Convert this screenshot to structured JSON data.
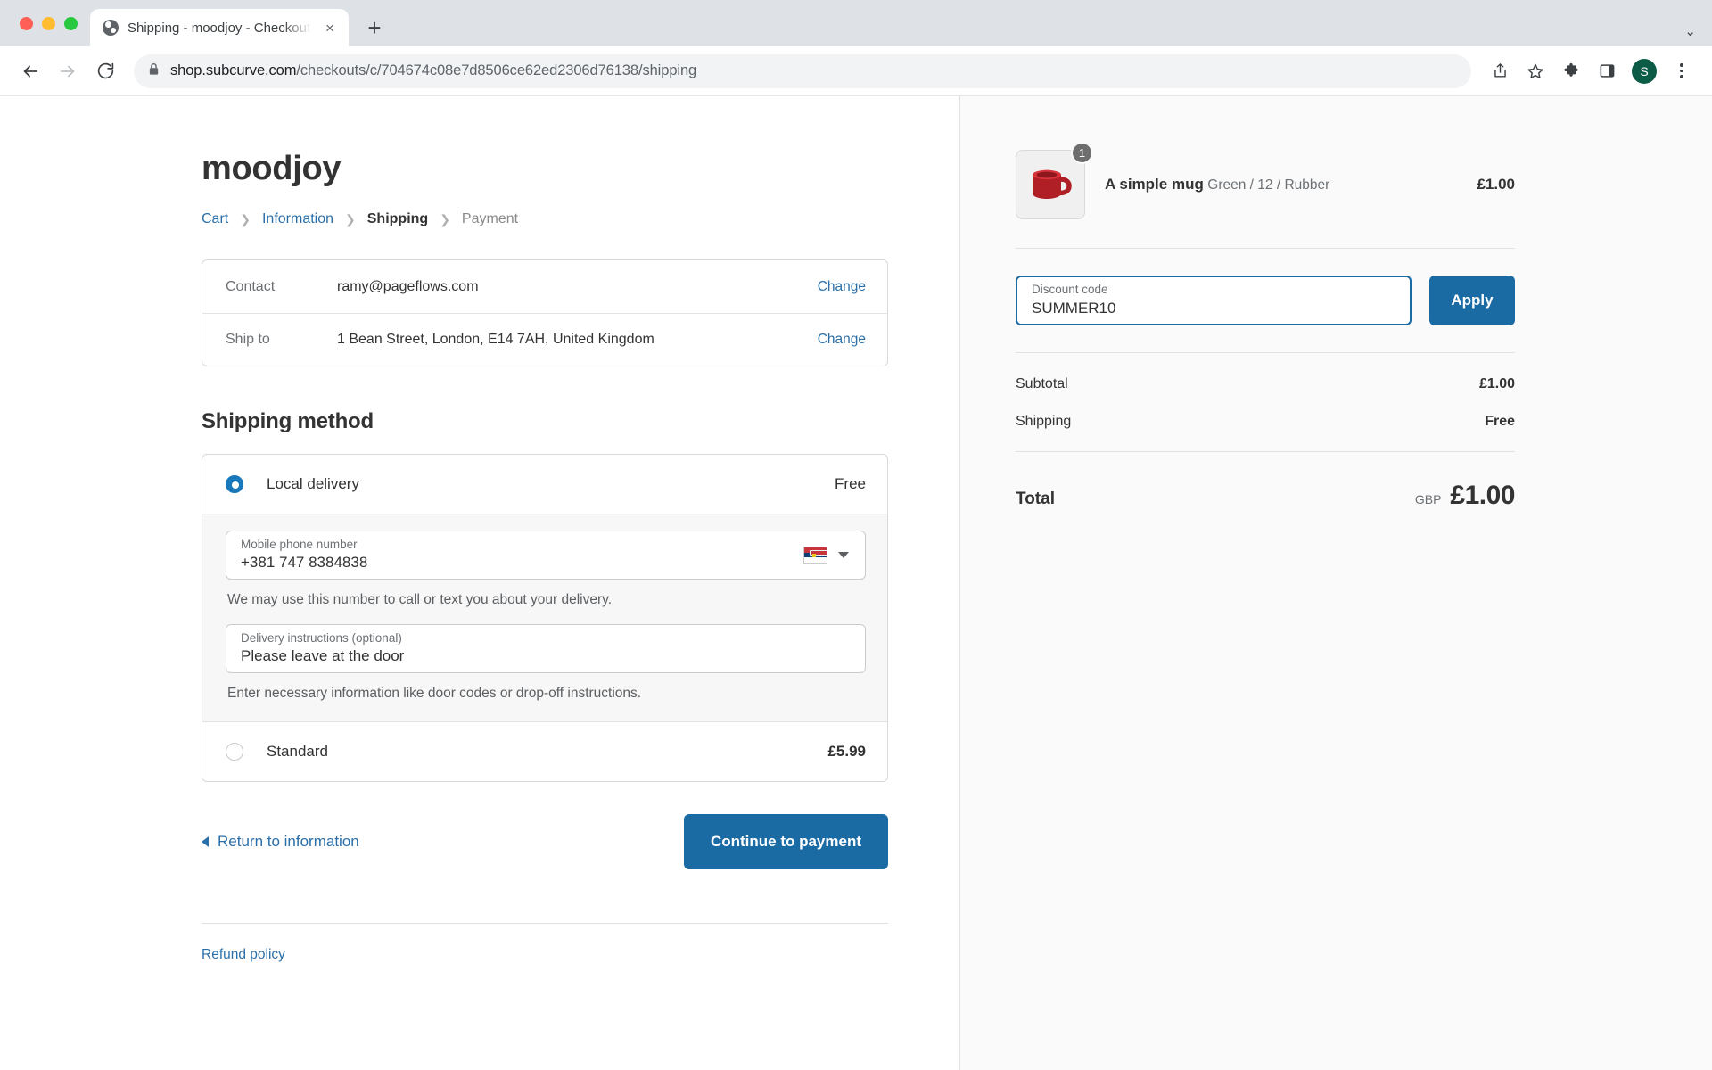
{
  "browser": {
    "tab": {
      "title": "Shipping - moodjoy - Checkout",
      "favicon": "globe-icon",
      "close": "×"
    },
    "new_tab_label": "+",
    "tabstrip_right": "⌄",
    "url_secure": "shop.subcurve.com",
    "url_path": "/checkouts/c/704674c08e7d8506ce62ed2306d76138/shipping",
    "avatar_initial": "S",
    "icons": [
      "back-arrow-icon",
      "forward-arrow-icon",
      "reload-icon",
      "lock-icon",
      "share-icon",
      "bookmark-star-icon",
      "extensions-puzzle-icon",
      "side-panel-icon",
      "profile-avatar",
      "chrome-menu-icon"
    ]
  },
  "checkout": {
    "shop_name": "moodjoy",
    "breadcrumb": [
      {
        "label": "Cart",
        "state": "link"
      },
      {
        "label": "Information",
        "state": "link"
      },
      {
        "label": "Shipping",
        "state": "current"
      },
      {
        "label": "Payment",
        "state": "upcoming"
      }
    ],
    "breadcrumb_separator": "❯",
    "info_rows": [
      {
        "label": "Contact",
        "value": "ramy@pageflows.com",
        "action": "Change"
      },
      {
        "label": "Ship to",
        "value": "1 Bean Street, London, E14 7AH, United Kingdom",
        "action": "Change"
      }
    ],
    "shipping_method_title": "Shipping method",
    "shipping_options": [
      {
        "label": "Local delivery",
        "price": "Free",
        "selected": true
      },
      {
        "label": "Standard",
        "price": "£5.99",
        "selected": false
      }
    ],
    "phone_field": {
      "label": "Mobile phone number",
      "value": "+381 747 8384838",
      "country_flag": "serbia-flag",
      "help": "We may use this number to call or text you about your delivery."
    },
    "instructions_field": {
      "label": "Delivery instructions (optional)",
      "value": "Please leave at the door",
      "help": "Enter necessary information like door codes or drop-off instructions."
    },
    "return_link": "Return to information",
    "continue_button": "Continue to payment",
    "refund_policy": "Refund policy"
  },
  "summary": {
    "line_item": {
      "title": "A simple mug",
      "variant": "Green / 12 / Rubber",
      "price": "£1.00",
      "quantity": "1",
      "image": "red-mug-thumbnail"
    },
    "discount": {
      "label": "Discount code",
      "value": "SUMMER10",
      "placeholder": "Discount code",
      "apply_label": "Apply"
    },
    "totals": [
      {
        "label": "Subtotal",
        "value": "£1.00"
      },
      {
        "label": "Shipping",
        "value": "Free"
      }
    ],
    "grand_total": {
      "label": "Total",
      "currency": "GBP",
      "amount": "£1.00"
    }
  },
  "colors": {
    "accent_blue": "#1a6aa4",
    "link_blue": "#2b6fa8",
    "panel_bg": "#fafafa"
  }
}
